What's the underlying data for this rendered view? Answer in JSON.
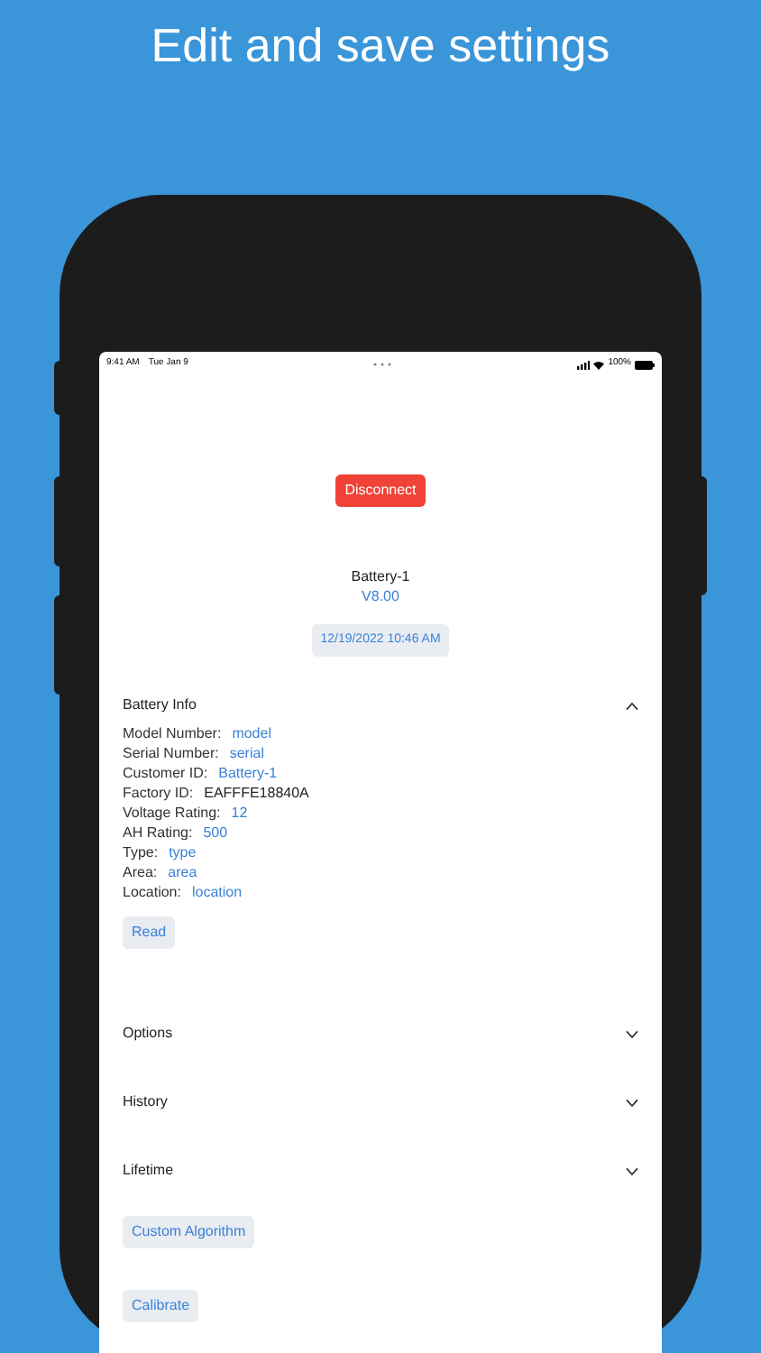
{
  "headline": "Edit and save settings",
  "status_bar": {
    "time": "9:41 AM",
    "date": "Tue Jan 9",
    "battery": "100%"
  },
  "disconnect_button": "Disconnect",
  "device": {
    "name": "Battery-1",
    "version": "V8.00"
  },
  "date_button": "12/19/2022 10:46 AM",
  "sections": [
    {
      "title": "Battery Info",
      "expanded": true,
      "fields": [
        {
          "label": "Model Number:",
          "value": "model",
          "editable": true
        },
        {
          "label": "Serial Number:",
          "value": "serial",
          "editable": true
        },
        {
          "label": "Customer ID:",
          "value": "Battery-1",
          "editable": true
        },
        {
          "label": "Factory ID:",
          "value": "EAFFFE18840A",
          "editable": false
        },
        {
          "label": "Voltage Rating:",
          "value": "12",
          "editable": true
        },
        {
          "label": "AH Rating:",
          "value": "500",
          "editable": true
        },
        {
          "label": "Type:",
          "value": "type",
          "editable": true
        },
        {
          "label": "Area:",
          "value": "area",
          "editable": true
        },
        {
          "label": "Location:",
          "value": "location",
          "editable": true
        }
      ],
      "button": "Read"
    },
    {
      "title": "Options",
      "expanded": false
    },
    {
      "title": "History",
      "expanded": false
    },
    {
      "title": "Lifetime",
      "expanded": false
    }
  ],
  "action_buttons": [
    "Custom Algorithm",
    "Calibrate"
  ]
}
